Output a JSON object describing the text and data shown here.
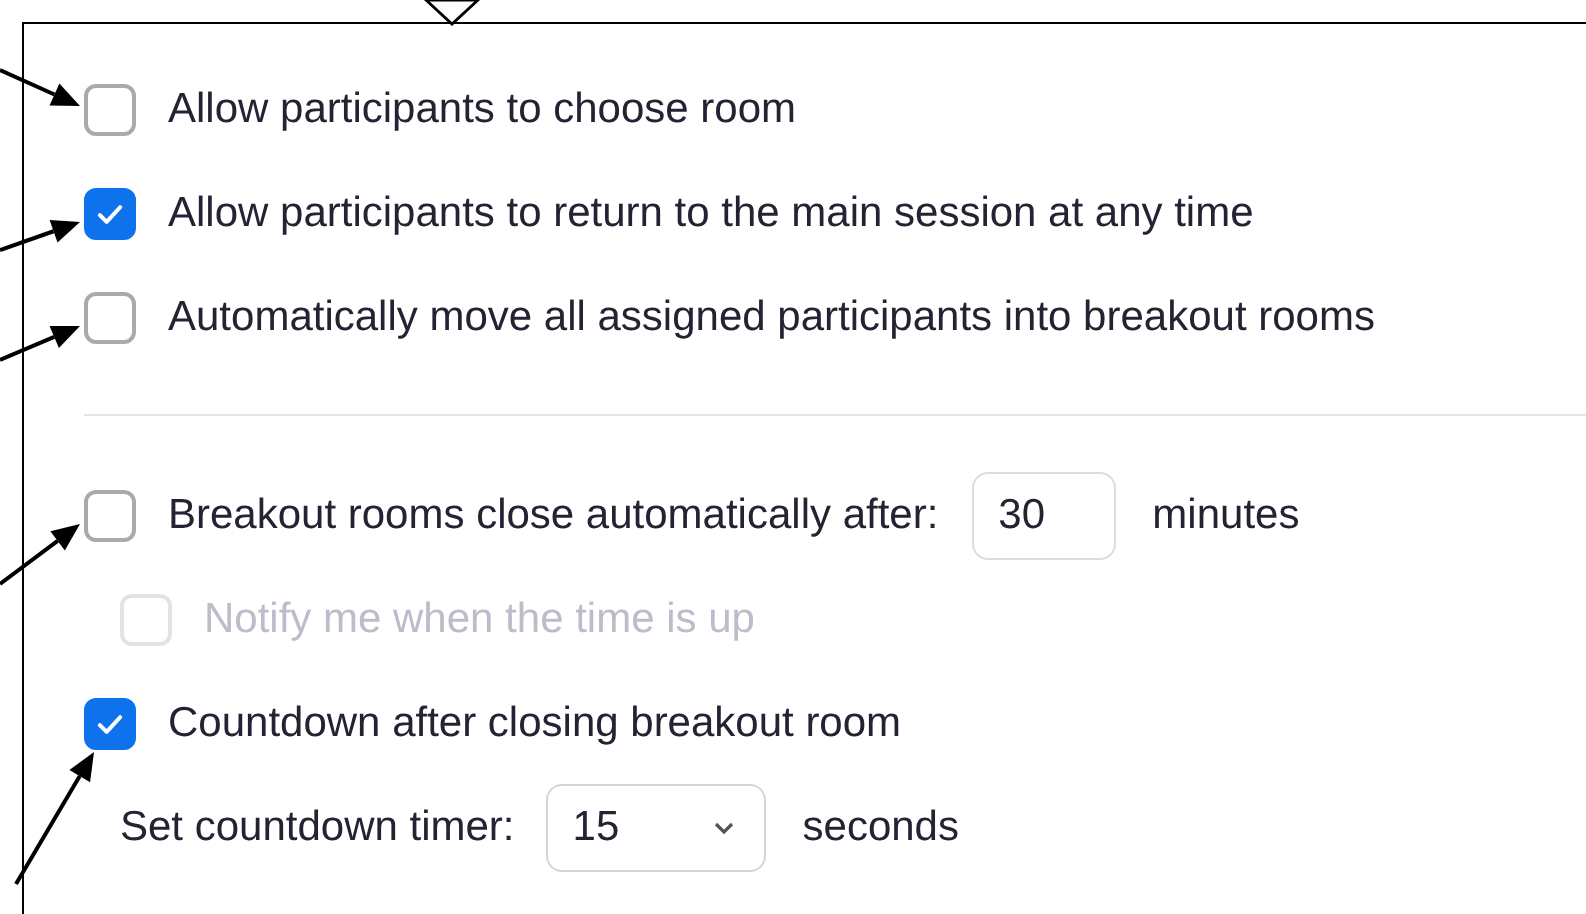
{
  "options": [
    {
      "kind": "checkbox",
      "label": "Allow participants to choose room",
      "checked": false,
      "disabled": false,
      "marked": true
    },
    {
      "kind": "checkbox",
      "label": "Allow participants to return to the main session at any time",
      "checked": true,
      "disabled": false,
      "marked": true
    },
    {
      "kind": "checkbox",
      "label": "Automatically move all assigned participants into breakout rooms",
      "checked": false,
      "disabled": false,
      "marked": true
    },
    {
      "kind": "divider"
    },
    {
      "kind": "checkbox",
      "label": "Breakout rooms close automatically after:",
      "checked": false,
      "disabled": false,
      "marked": true,
      "field": {
        "value": "30"
      },
      "unit": "minutes",
      "children": [
        {
          "kind": "checkbox",
          "label": "Notify me when the time is up",
          "checked": false,
          "disabled": true,
          "marked": false
        }
      ]
    },
    {
      "kind": "checkbox",
      "label": "Countdown after closing breakout room",
      "checked": true,
      "disabled": false,
      "marked": true,
      "children": [
        {
          "kind": "select",
          "label": "Set countdown timer:",
          "value": "15",
          "unit": "seconds"
        }
      ]
    }
  ]
}
